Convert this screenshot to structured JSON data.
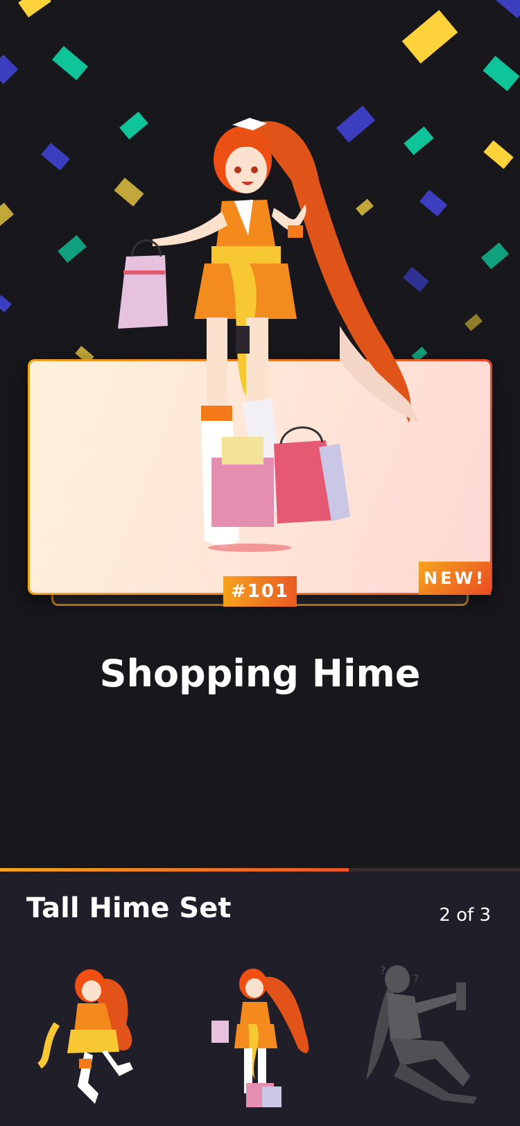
{
  "colors": {
    "background": "#18171c",
    "panel": "#201f29",
    "accent_orange": "#f2a31e",
    "accent_red": "#e8552a",
    "confetti_yellow": "#fdd23b",
    "confetti_teal": "#10c49a",
    "confetti_blue": "#3b3fbf",
    "confetti_olive": "#c2a83a"
  },
  "hero": {
    "icon": "character-illustration-shopping-hime",
    "badge_new": "NEW!",
    "number": "#101",
    "name": "Shopping Hime"
  },
  "progress": {
    "value": 0.67
  },
  "set": {
    "title": "Tall Hime Set",
    "count": "2 of 3",
    "items": [
      {
        "icon": "hime-jumping-icon",
        "state": "unlocked"
      },
      {
        "icon": "hime-shopping-icon",
        "state": "unlocked"
      },
      {
        "icon": "hime-sitting-silhouette-icon",
        "state": "locked"
      }
    ]
  }
}
